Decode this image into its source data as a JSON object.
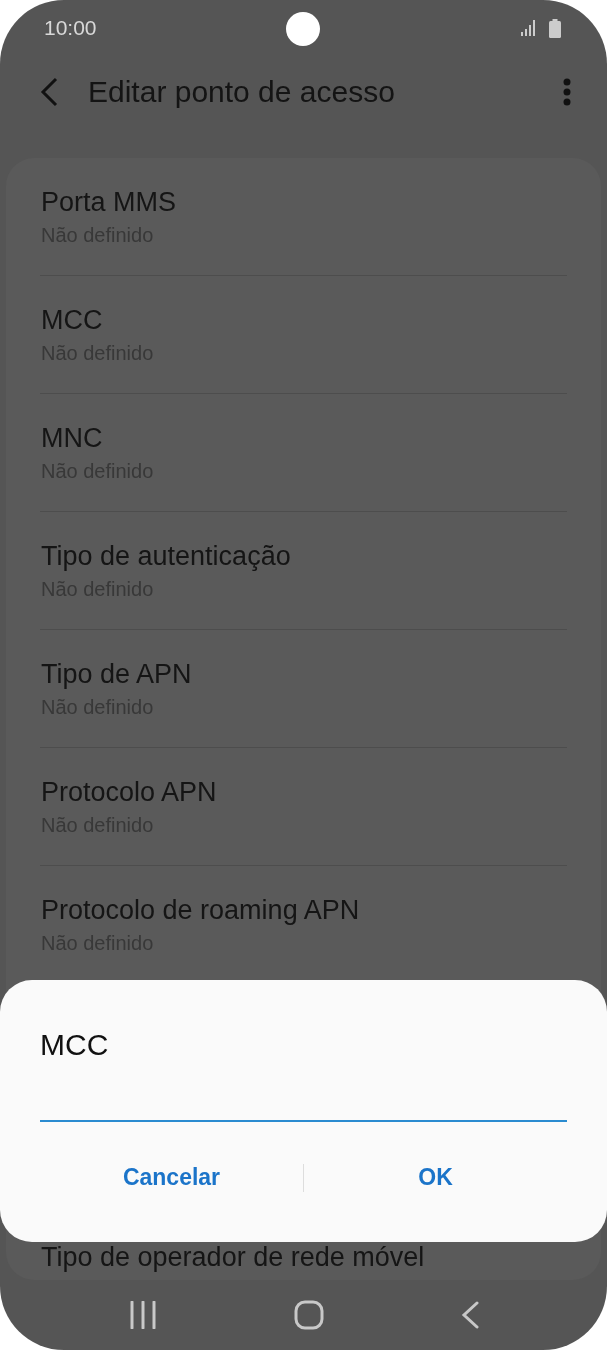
{
  "status_bar": {
    "time": "10:00"
  },
  "header": {
    "title": "Editar ponto de acesso"
  },
  "settings": [
    {
      "title": "Porta MMS",
      "value": "Não definido"
    },
    {
      "title": "MCC",
      "value": "Não definido"
    },
    {
      "title": "MNC",
      "value": "Não definido"
    },
    {
      "title": "Tipo de autenticação",
      "value": "Não definido"
    },
    {
      "title": "Tipo de APN",
      "value": "Não definido"
    },
    {
      "title": "Protocolo APN",
      "value": "Não definido"
    },
    {
      "title": "Protocolo de roaming APN",
      "value": "Não definido"
    },
    {
      "title": "Tipo de operador de rede móvel"
    }
  ],
  "dialog": {
    "title": "MCC",
    "buttons": [
      "Cancelar",
      "OK"
    ]
  }
}
